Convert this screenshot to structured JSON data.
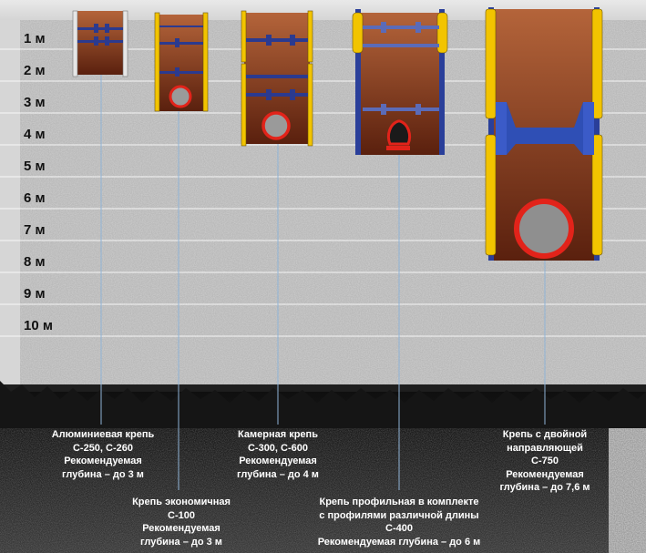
{
  "depth_scale": {
    "unit": "м",
    "labels": [
      "1 м",
      "2 м",
      "3 м",
      "4 м",
      "5 м",
      "6 м",
      "7 м",
      "8 м",
      "9 м",
      "10 м"
    ]
  },
  "shoring_systems": [
    {
      "id": "aluminium",
      "lines": [
        "Алюминиевая крепь",
        "С-250, С-260",
        "Рекомендуемая",
        "глубина – до 3 м"
      ]
    },
    {
      "id": "economy",
      "lines": [
        "Крепь экономичная",
        "С-100",
        "Рекомендуемая",
        "глубина – до 3 м"
      ]
    },
    {
      "id": "chamber",
      "lines": [
        "Камерная крепь",
        "С-300, С-600",
        "Рекомендуемая",
        "глубина – до 4 м"
      ]
    },
    {
      "id": "profile",
      "lines": [
        "Крепь профильная в комплекте",
        "с профилями различной длины",
        "С-400",
        "Рекомендуемая глубина – до 6 м"
      ]
    },
    {
      "id": "double-guide",
      "lines": [
        "Крепь с двойной",
        "направляющей",
        "С-750",
        "Рекомендуемая",
        "глубина – до 7,6 м"
      ]
    }
  ],
  "colors": {
    "soil": "#b9b9b9",
    "trench_top": "#ab5a32",
    "trench_bottom": "#5e2210",
    "guide_yellow": "#f2c400",
    "frame_blue": "#2a3f9a",
    "pipe_red": "#e2231a",
    "pipe_grey": "#8f8f8f"
  }
}
